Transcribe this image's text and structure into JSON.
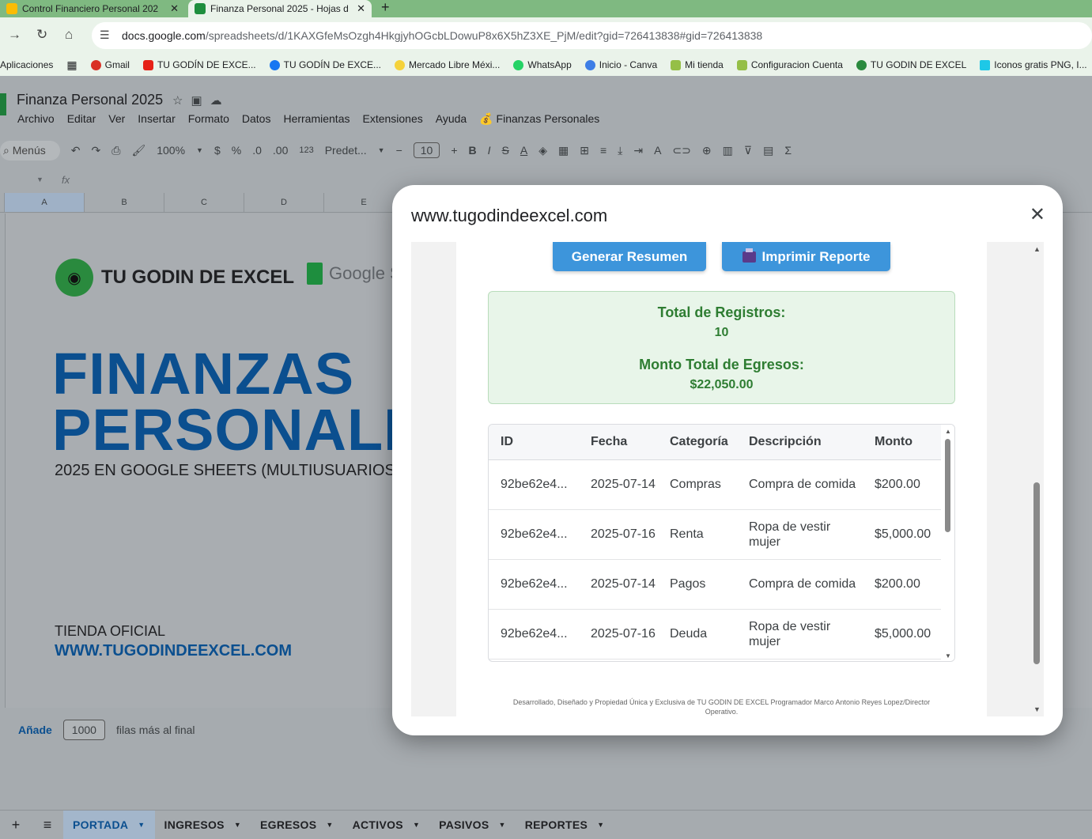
{
  "browser": {
    "tabs": [
      {
        "label": "Control Financiero Personal 202",
        "close": "✕"
      },
      {
        "label": "Finanza Personal 2025 - Hojas d",
        "close": "✕"
      }
    ],
    "new_tab": "+",
    "url_host": "docs.google.com",
    "url_path": "/spreadsheets/d/1KAXGfeMsOzgh4HkgjyhOGcbLDowuP8x6X5hZ3XE_PjM/edit?gid=726413838#gid=726413838",
    "bookmarks": [
      {
        "label": "Aplicaciones",
        "color": ""
      },
      {
        "label": "Gmail",
        "color": "#d93025"
      },
      {
        "label": "TU GODÍN DE EXCE...",
        "color": "#e62117"
      },
      {
        "label": "TU GODÍN De EXCE...",
        "color": "#1877f2"
      },
      {
        "label": "Mercado Libre Méxi...",
        "color": "#f5d23b"
      },
      {
        "label": "WhatsApp",
        "color": "#25d366"
      },
      {
        "label": "Inicio - Canva",
        "color": "#3e7ee6"
      },
      {
        "label": "Mi tienda",
        "color": "#95bf47"
      },
      {
        "label": "Configuracion Cuenta",
        "color": "#95bf47"
      },
      {
        "label": "TU GODIN DE EXCEL",
        "color": "#2a8a3e"
      },
      {
        "label": "Iconos gratis PNG, I...",
        "color": "#1ec8e7"
      }
    ]
  },
  "sheets": {
    "title": "Finanza Personal 2025",
    "menu": [
      "Archivo",
      "Editar",
      "Ver",
      "Insertar",
      "Formato",
      "Datos",
      "Herramientas",
      "Extensiones",
      "Ayuda",
      "💰 Finanzas Personales"
    ],
    "toolbar": {
      "search": "Menús",
      "zoom": "100%",
      "currency": "$",
      "percent": "%",
      "dec_less": ".0",
      "dec_more": ".00",
      "num_format": "123",
      "font": "Predet...",
      "font_size": "10"
    },
    "fx": "fx",
    "columns": [
      "A",
      "B",
      "C",
      "D",
      "E"
    ],
    "cover": {
      "brand": "TU GODIN DE EXCEL",
      "google_sheets": "Google S",
      "hero_line1": "FINANZAS",
      "hero_line2": "PERSONALE",
      "subtitle": "2025 EN GOOGLE SHEETS (MULTIUSUARIOS)",
      "store_label": "TIENDA OFICIAL",
      "store_url": "WWW.TUGODINDEEXCEL.COM"
    },
    "add_rows": {
      "add_label": "Añade",
      "count": "1000",
      "suffix": "filas más al final"
    },
    "sheet_tabs": [
      "PORTADA",
      "INGRESOS",
      "EGRESOS",
      "ACTIVOS",
      "PASIVOS",
      "REPORTES"
    ],
    "active_tab": "PORTADA"
  },
  "modal": {
    "title": "www.tugodindeexcel.com",
    "close": "✕",
    "buttons": {
      "generate": "Generar Resumen",
      "print": "Imprimir Reporte"
    },
    "summary": {
      "records_label": "Total de Registros:",
      "records_value": "10",
      "total_label": "Monto Total de Egresos:",
      "total_value": "$22,050.00"
    },
    "table": {
      "headers": [
        "ID",
        "Fecha",
        "Categoría",
        "Descripción",
        "Monto"
      ],
      "rows": [
        [
          "92be62e4...",
          "2025-07-14",
          "Compras",
          "Compra de comida",
          "$200.00"
        ],
        [
          "92be62e4...",
          "2025-07-16",
          "Renta",
          "Ropa de vestir mujer",
          "$5,000.00"
        ],
        [
          "92be62e4...",
          "2025-07-14",
          "Pagos",
          "Compra de comida",
          "$200.00"
        ],
        [
          "92be62e4...",
          "2025-07-16",
          "Deuda",
          "Ropa de vestir mujer",
          "$5,000.00"
        ]
      ]
    },
    "footer": "Desarrollado, Diseñado y Propiedad Única y Exclusiva de TU GODIN DE EXCEL Programador Marco Antonio Reyes Lopez/Director Operativo."
  }
}
